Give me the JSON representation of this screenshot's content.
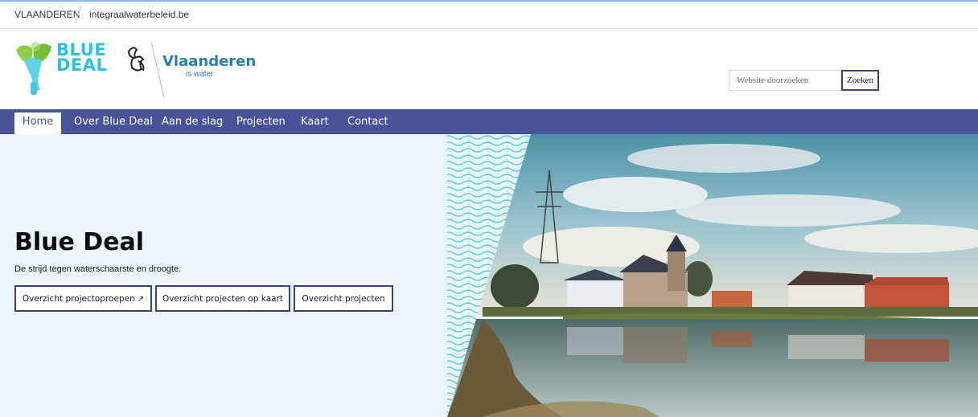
{
  "topbar": {
    "gov_label": "VLAANDEREN",
    "site_label": "integraalwaterbeleid.be"
  },
  "header": {
    "bluedeal_logo": {
      "line1": "BLUE",
      "line2": "DEAL"
    },
    "vlaanderen_logo": {
      "title": "Vlaanderen",
      "subtitle": "is water"
    }
  },
  "search": {
    "placeholder": "Website doorzoeken",
    "button_label": "Zoeken"
  },
  "nav": {
    "items": [
      {
        "label": "Home",
        "active": true
      },
      {
        "label": "Over Blue Deal"
      },
      {
        "label": "Aan de slag"
      },
      {
        "label": "Projecten"
      },
      {
        "label": "Kaart"
      },
      {
        "label": "Contact"
      }
    ]
  },
  "hero": {
    "title": "Blue Deal",
    "subtitle": "De strijd tegen waterschaarste en droogte.",
    "buttons": [
      {
        "label": "Overzicht projectoproepen",
        "icon": "external-link-icon"
      },
      {
        "label": "Overzicht projecten op kaart"
      },
      {
        "label": "Overzicht projecten"
      }
    ],
    "photo": "village by canal with reflection"
  },
  "colors": {
    "nav_bg": "#48539a",
    "hero_bg": "#e9f6fb",
    "button_border": "#3e3e78",
    "bluedeal_accent": "#2fc1e0",
    "vlaanderen_accent": "#2b7fa6"
  }
}
